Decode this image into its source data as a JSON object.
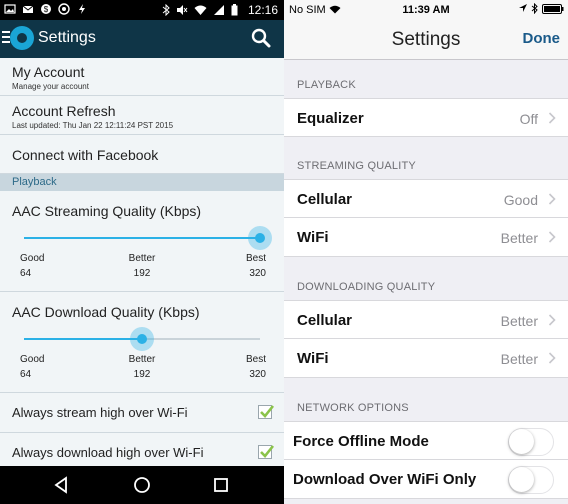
{
  "android": {
    "status_bar": {
      "clock": "12:16",
      "icons": [
        "image-icon",
        "email-icon",
        "soundcloud-icon",
        "bluetooth-icon",
        "wifi-icon",
        "battery-icon"
      ]
    },
    "app_bar": {
      "title": "Settings",
      "search_icon": "search-icon"
    },
    "rows": {
      "my_account": {
        "title": "My Account",
        "subtitle": "Manage your account"
      },
      "account_refresh": {
        "title": "Account Refresh",
        "subtitle": "Last updated: Thu Jan 22 12:11:24 PST 2015"
      },
      "facebook": {
        "title": "Connect with Facebook"
      }
    },
    "section_playback": "Playback",
    "streaming_slider": {
      "label": "AAC Streaming Quality (Kbps)",
      "value": 1.0,
      "ticks": [
        {
          "name": "Good",
          "kbps": "64"
        },
        {
          "name": "Better",
          "kbps": "192"
        },
        {
          "name": "Best",
          "kbps": "320"
        }
      ]
    },
    "download_slider": {
      "label": "AAC Download Quality (Kbps)",
      "value": 0.5,
      "ticks": [
        {
          "name": "Good",
          "kbps": "64"
        },
        {
          "name": "Better",
          "kbps": "192"
        },
        {
          "name": "Best",
          "kbps": "320"
        }
      ]
    },
    "checks": [
      {
        "label": "Always stream high over Wi-Fi",
        "checked": true
      },
      {
        "label": "Always download high over Wi-Fi",
        "checked": true
      }
    ],
    "accent": "#2bb1e6"
  },
  "ios": {
    "status_bar": {
      "carrier": "No SIM",
      "time": "11:39 AM"
    },
    "nav": {
      "title": "Settings",
      "done": "Done"
    },
    "sections": {
      "playback": "PLAYBACK",
      "streaming": "STREAMING QUALITY",
      "downloading": "DOWNLOADING QUALITY",
      "network": "NETWORK OPTIONS"
    },
    "cells": {
      "equalizer": {
        "label": "Equalizer",
        "value": "Off"
      },
      "stream_cellular": {
        "label": "Cellular",
        "value": "Good"
      },
      "stream_wifi": {
        "label": "WiFi",
        "value": "Better"
      },
      "dl_cellular": {
        "label": "Cellular",
        "value": "Better"
      },
      "dl_wifi": {
        "label": "WiFi",
        "value": "Better"
      },
      "offline": {
        "label": "Force Offline Mode",
        "on": false
      },
      "wifi_only": {
        "label": "Download Over WiFi Only",
        "on": false
      }
    },
    "accent": "#1a5a89"
  }
}
